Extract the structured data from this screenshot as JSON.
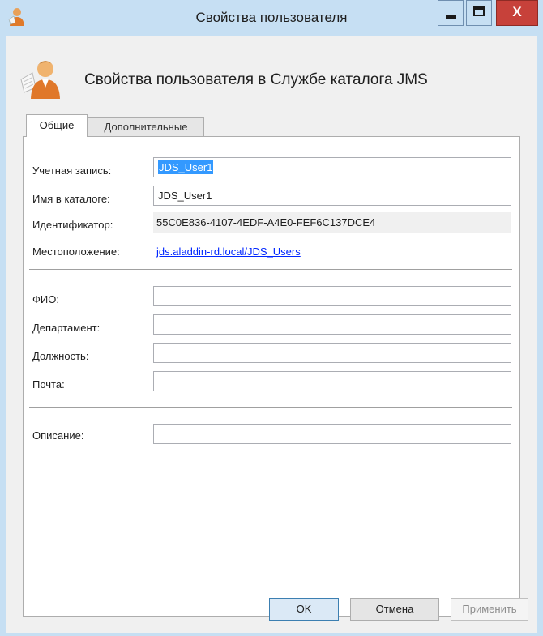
{
  "window": {
    "title": "Свойства пользователя",
    "header_title": "Свойства пользователя в Службе каталога JMS",
    "close_label": "X"
  },
  "tabs": [
    {
      "label": "Общие",
      "active": true
    },
    {
      "label": "Дополнительные",
      "active": false
    }
  ],
  "form": {
    "account_label": "Учетная запись:",
    "account_value": "JDS_User1",
    "dirname_label": "Имя в каталоге:",
    "dirname_value": "JDS_User1",
    "id_label": "Идентификатор:",
    "id_value": "55C0E836-4107-4EDF-A4E0-FEF6C137DCE4",
    "location_label": "Местоположение:",
    "location_value": "jds.aladdin-rd.local/JDS_Users",
    "fio_label": "ФИО:",
    "fio_value": "",
    "department_label": "Департамент:",
    "department_value": "",
    "position_label": "Должность:",
    "position_value": "",
    "mail_label": "Почта:",
    "mail_value": "",
    "description_label": "Описание:",
    "description_value": ""
  },
  "buttons": {
    "ok": "OK",
    "cancel": "Отмена",
    "apply": "Применить"
  },
  "icons": {
    "app": "user-properties-icon",
    "header": "user-icon"
  },
  "colors": {
    "accent": "#3399ff",
    "link": "#0026ff",
    "close": "#c7413a"
  }
}
